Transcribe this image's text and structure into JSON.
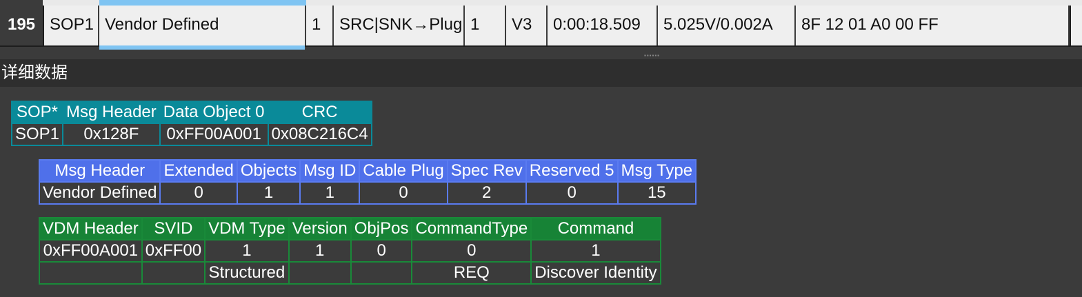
{
  "packet_row": {
    "index": "195",
    "sop": "SOP1",
    "msg": "Vendor Defined",
    "col4": "1",
    "role": "SRC|SNK→Plug",
    "col6": "1",
    "rev": "V3",
    "time": "0:00:18.509",
    "vbus": "5.025V/0.002A",
    "raw": "8F 12 01 A0 00 FF"
  },
  "section_title": "详细数据",
  "table1": {
    "headers": [
      "SOP*",
      "Msg Header",
      "Data Object 0",
      "CRC"
    ],
    "values": [
      "SOP1",
      "0x128F",
      "0xFF00A001",
      "0x08C216C4"
    ]
  },
  "table2": {
    "headers": [
      "Msg Header",
      "Extended",
      "Objects",
      "Msg ID",
      "Cable Plug",
      "Spec Rev",
      "Reserved 5",
      "Msg Type"
    ],
    "values": [
      "Vendor Defined",
      "0",
      "1",
      "1",
      "0",
      "2",
      "0",
      "15"
    ]
  },
  "table3": {
    "headers": [
      "VDM Header",
      "SVID",
      "VDM Type",
      "Version",
      "ObjPos",
      "CommandType",
      "Command"
    ],
    "values": [
      "0xFF00A001",
      "0xFF00",
      "1",
      "1",
      "0",
      "0",
      "1"
    ],
    "decoded": [
      "",
      "",
      "Structured",
      "",
      "",
      "REQ",
      "Discover Identity"
    ]
  },
  "colors": {
    "table1": "#0a8a99",
    "table2": "#4f70ea",
    "table3": "#178336",
    "selection": "#7fc4f2"
  }
}
